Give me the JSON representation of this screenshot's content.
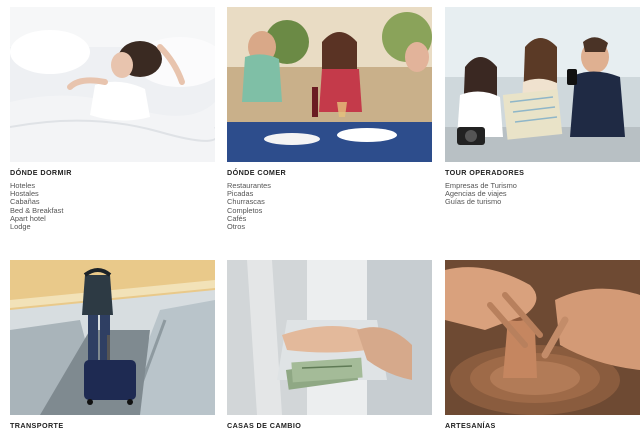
{
  "cards": [
    {
      "title": "DÓNDE DORMIR",
      "links": [
        "Hoteles",
        "Hostales",
        "Cabañas",
        "Bed & Breakfast",
        "Apart hotel",
        "Lodge"
      ]
    },
    {
      "title": "DÓNDE COMER",
      "links": [
        "Restaurantes",
        "Picadas",
        "Churrascas",
        "Completos",
        "Cafés",
        "Otros"
      ]
    },
    {
      "title": "TOUR OPERADORES",
      "links": [
        "Empresas de Turismo",
        "Agencias de viajes",
        "Guías de turismo"
      ]
    },
    {
      "title": "TRANSPORTE",
      "links": []
    },
    {
      "title": "CASAS DE CAMBIO",
      "links": []
    },
    {
      "title": "ARTESANÍAS",
      "links": []
    }
  ]
}
